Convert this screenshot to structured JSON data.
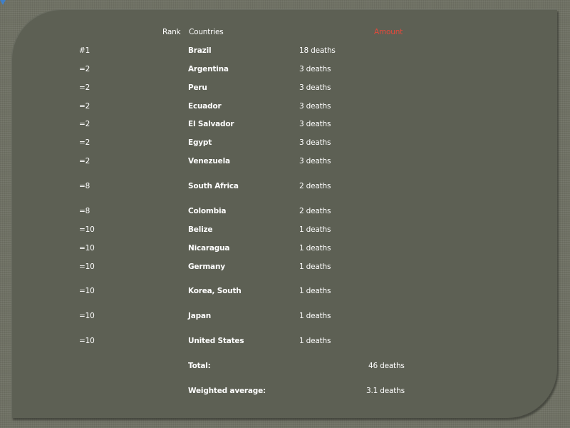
{
  "header": {
    "rank": "Rank",
    "countries": "Countries",
    "amount": "Amount"
  },
  "rows": [
    {
      "rank": "#1",
      "country": "Brazil",
      "amount": "18 deaths"
    },
    {
      "rank": "=2",
      "country": "Argentina",
      "amount": "3 deaths"
    },
    {
      "rank": "=2",
      "country": "Peru",
      "amount": "3 deaths"
    },
    {
      "rank": "=2",
      "country": "Ecuador",
      "amount": "3 deaths"
    },
    {
      "rank": "=2",
      "country": "El Salvador",
      "amount": "3 deaths"
    },
    {
      "rank": "=2",
      "country": "Egypt",
      "amount": "3 deaths"
    },
    {
      "rank": "=2",
      "country": "Venezuela",
      "amount": "3 deaths"
    },
    {
      "rank": "=8",
      "country": "South Africa",
      "amount": "2 deaths"
    },
    {
      "rank": "=8",
      "country": "Colombia",
      "amount": "2 deaths"
    },
    {
      "rank": "=10",
      "country": "Belize",
      "amount": "1 deaths"
    },
    {
      "rank": "=10",
      "country": "Nicaragua",
      "amount": "1 deaths"
    },
    {
      "rank": "=10",
      "country": "Germany",
      "amount": "1 deaths"
    },
    {
      "rank": "=10",
      "country": "Korea, South",
      "amount": "1 deaths"
    },
    {
      "rank": "=10",
      "country": "Japan",
      "amount": "1 deaths"
    },
    {
      "rank": "=10",
      "country": "United States",
      "amount": "1 deaths"
    }
  ],
  "summary": {
    "total_label": "Total:",
    "total_value": "46 deaths",
    "average_label": "Weighted average:",
    "average_value": "3.1 deaths"
  },
  "colors": {
    "background": "#6f7164",
    "card": "#5d6054",
    "text": "#ffffff",
    "amount_header": "#e04a3c",
    "corner_marker": "#3f7fc8"
  }
}
